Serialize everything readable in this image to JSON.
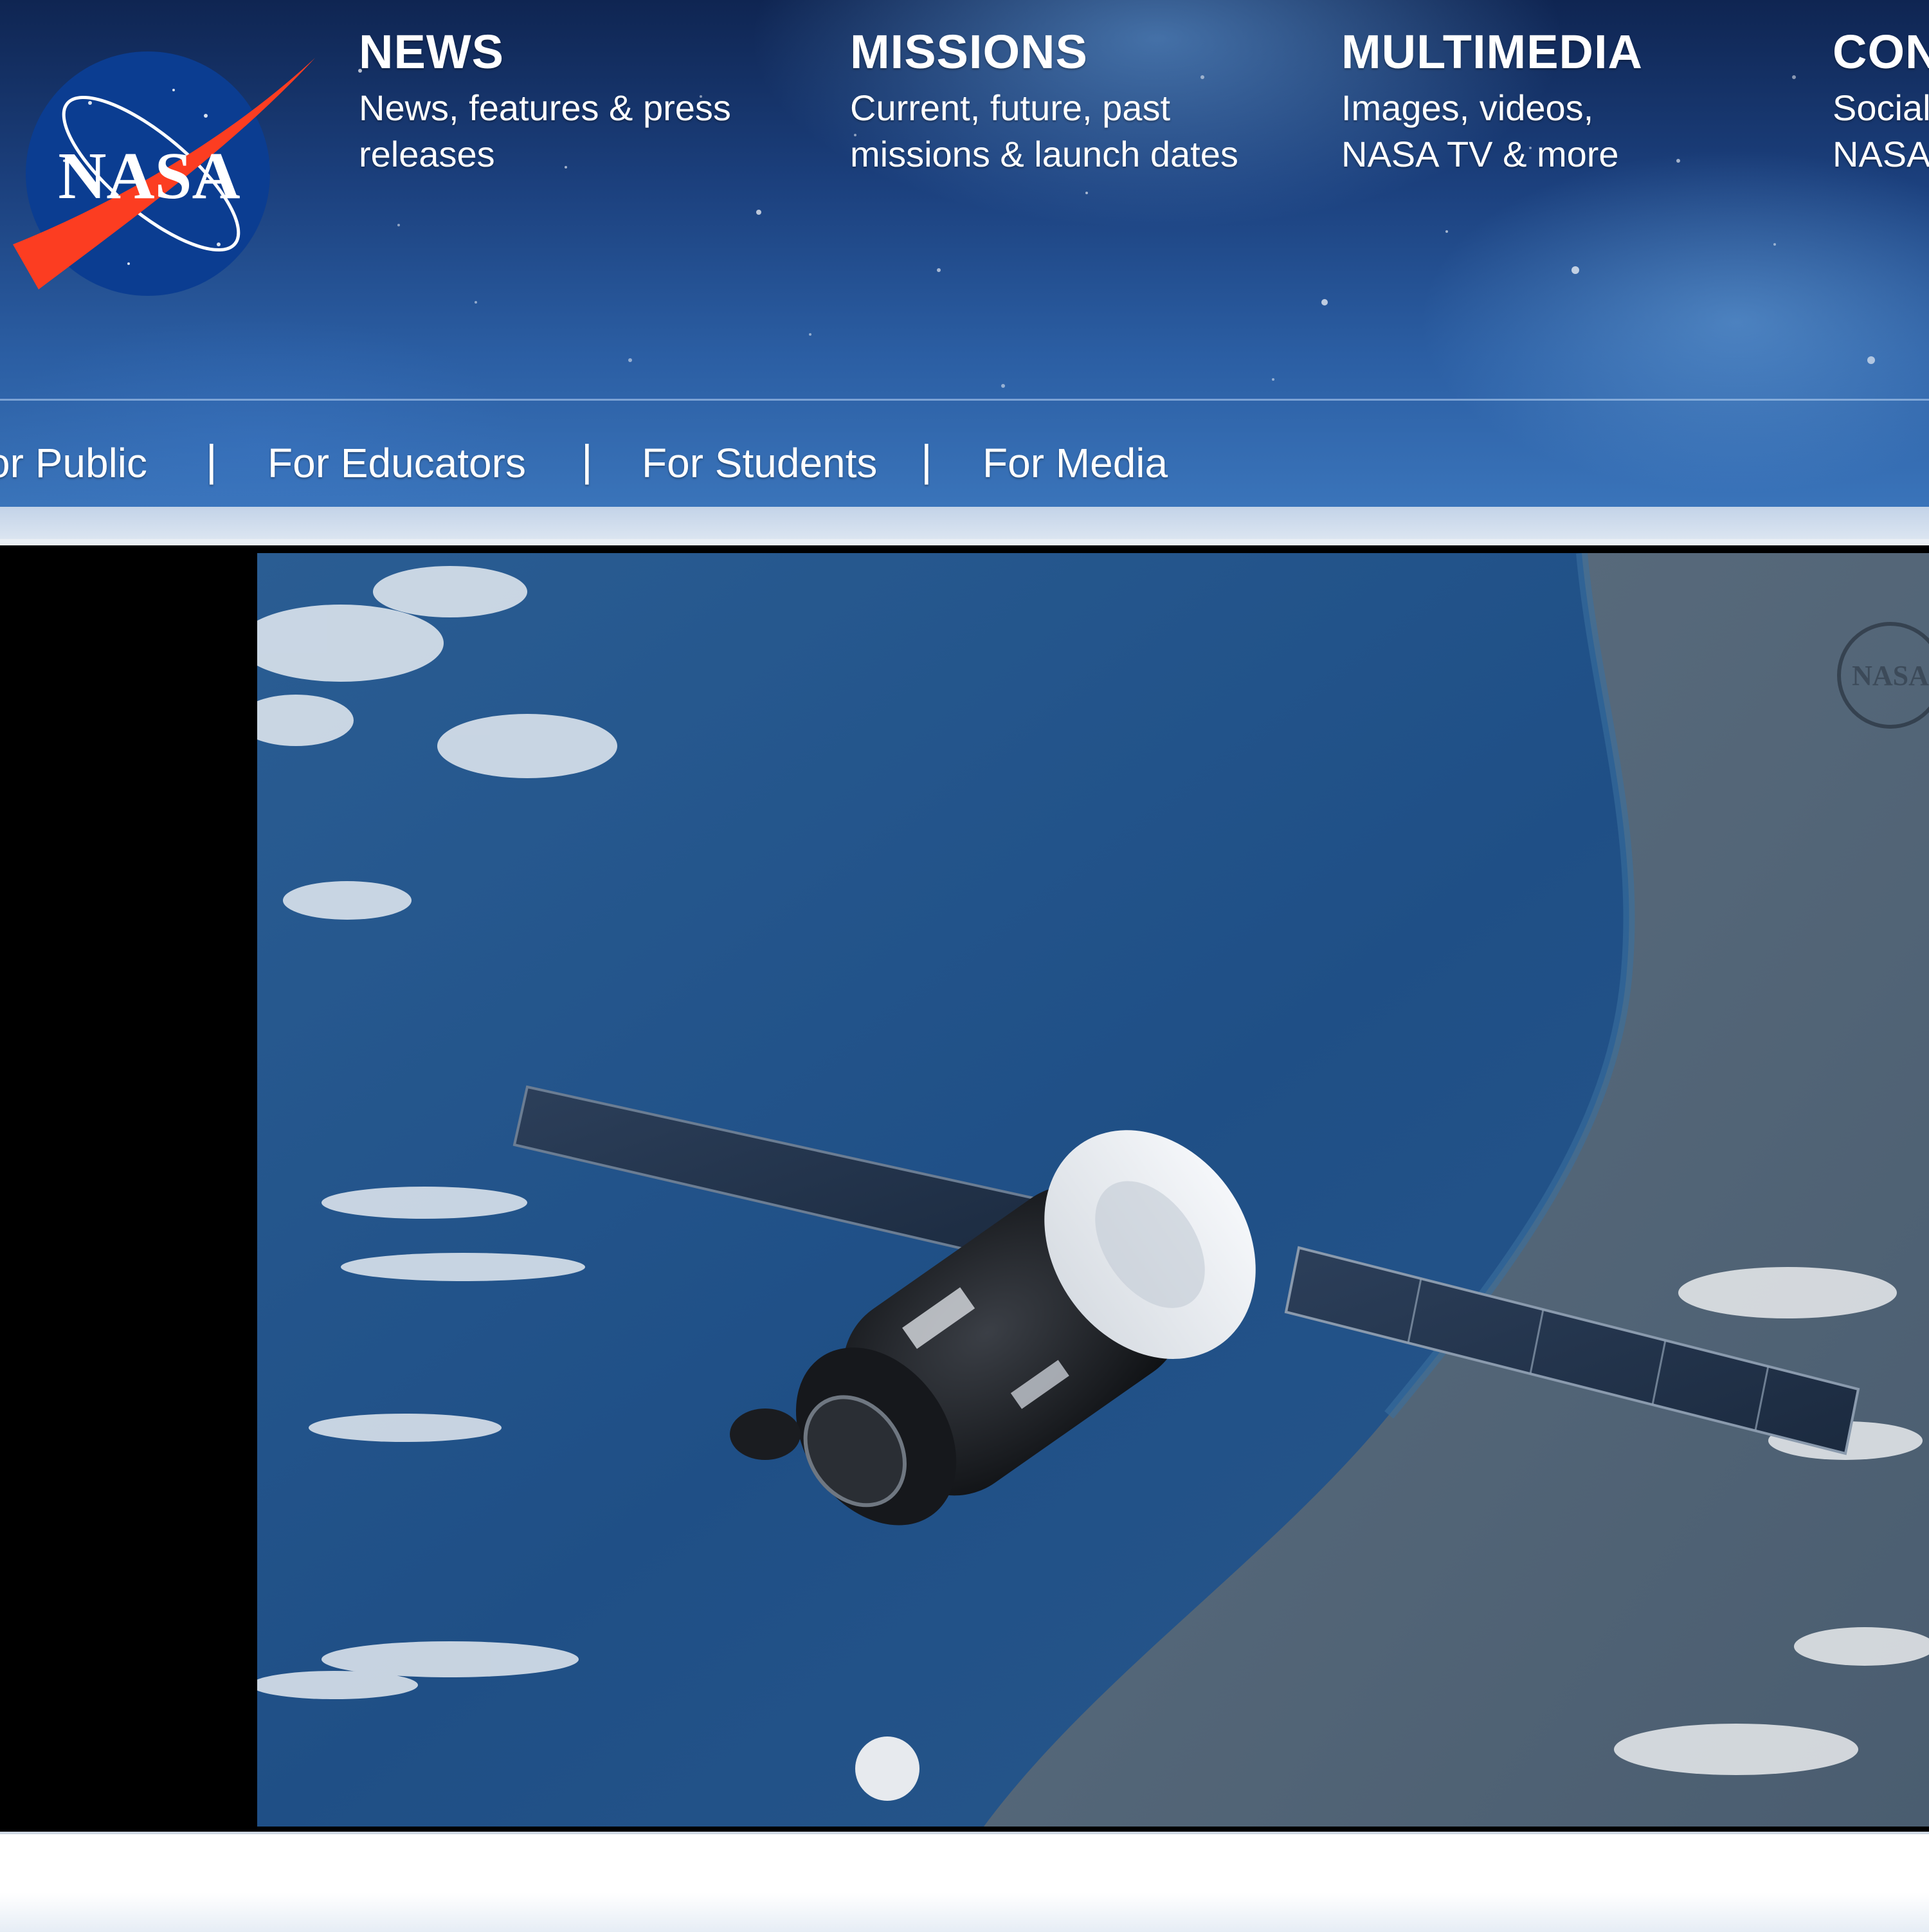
{
  "header": {
    "logo_text": "NASA",
    "nav": [
      {
        "title": "NEWS",
        "desc": "News, features & press releases"
      },
      {
        "title": "MISSIONS",
        "desc": "Current, future, past missions & launch dates"
      },
      {
        "title": "MULTIMEDIA",
        "desc": "Images, videos, NASA TV & more"
      },
      {
        "title": "CON",
        "desc": "Social NASA"
      }
    ],
    "audience": [
      {
        "label": "or Public"
      },
      {
        "label": "For Educators"
      },
      {
        "label": "For Students"
      },
      {
        "label": "For Media"
      }
    ],
    "separator": "|"
  },
  "video": {
    "watermark_text": "NASA"
  },
  "colors": {
    "nasa_blue": "#0b3d91",
    "nasa_red": "#fc3d21",
    "header_blue": "#2b5ea3"
  }
}
